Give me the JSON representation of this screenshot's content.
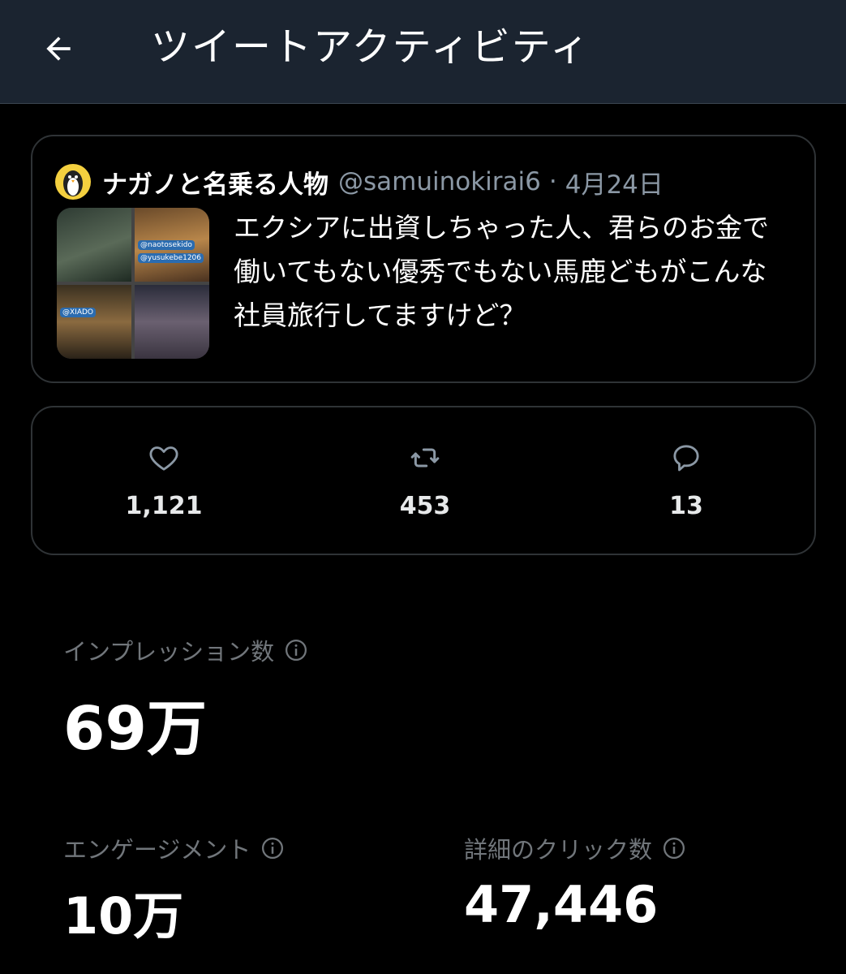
{
  "header": {
    "title": "ツイートアクティビティ",
    "back_icon": "arrow-left-icon"
  },
  "tweet": {
    "author_name": "ナガノと名乗る人物",
    "author_handle": "@samuinokirai6",
    "separator": "·",
    "date": "4月24日",
    "avatar_icon": "penguin-avatar-icon",
    "text": "エクシアに出資しちゃった人、君らのお金で働いてもない優秀でもない馬鹿どもがこんな社員旅行してますけど？",
    "media_overlay_tags": [
      "@naotosekido",
      "@yusukebe1206",
      "@XIADO"
    ]
  },
  "engagement": {
    "likes": "1,121",
    "retweets": "453",
    "replies": "13",
    "like_icon": "heart-icon",
    "retweet_icon": "retweet-icon",
    "reply_icon": "reply-bubble-icon"
  },
  "metrics": {
    "impressions_label": "インプレッション数",
    "impressions_value": "69万",
    "engagements_label": "エンゲージメント",
    "engagements_value": "10万",
    "detail_clicks_label": "詳細のクリック数",
    "detail_clicks_value": "47,446",
    "info_icon": "info-circle-icon"
  },
  "colors": {
    "background": "#000000",
    "header_background": "#1b2430",
    "border": "#2f3336",
    "secondary_text": "#71767b"
  }
}
